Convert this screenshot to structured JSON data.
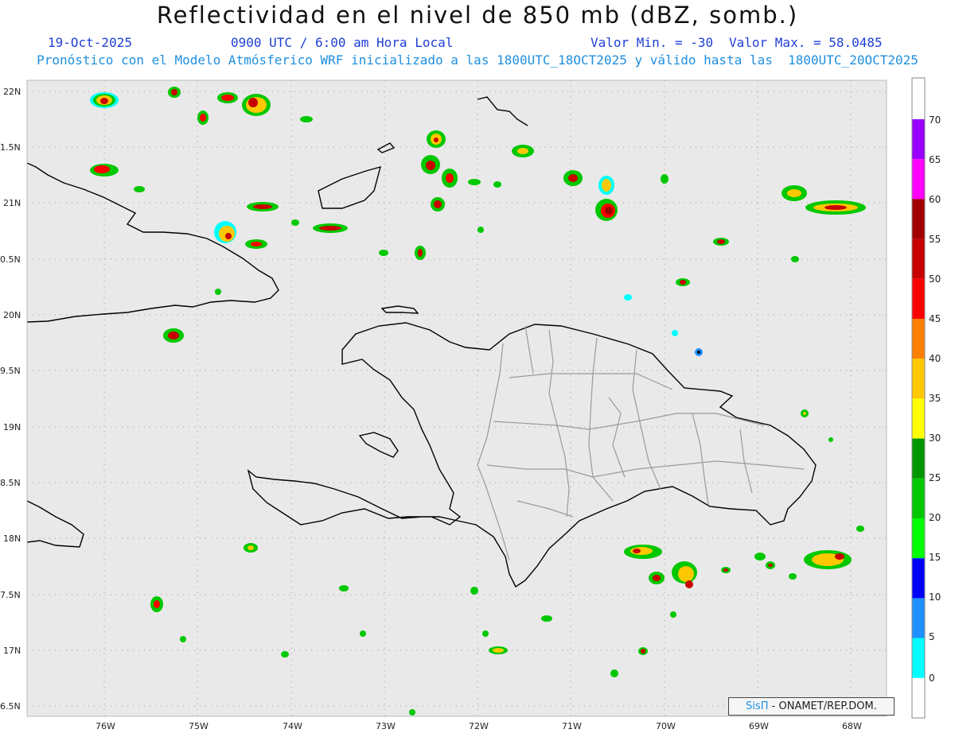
{
  "header": {
    "title": "Reflectividad en el nivel de 850 mb (dBZ, somb.)",
    "date": "19-Oct-2025",
    "time": "0900 UTC / 6:00 am Hora Local",
    "min_label": "Valor Min. = -30",
    "max_label": "Valor Max. = 58.0485",
    "subtitle": "Pronóstico con el Modelo Atmósferico WRF inicializado a las 1800UTC_18OCT2025 y válido hasta las  1800UTC_20OCT2025"
  },
  "axes": {
    "lat_labels": [
      "22N",
      "1.5N",
      "21N",
      "0.5N",
      "20N",
      "9.5N",
      "19N",
      "8.5N",
      "18N",
      "7.5N",
      "17N",
      "6.5N"
    ],
    "lon_labels": [
      "76W",
      "75W",
      "74W",
      "73W",
      "72W",
      "71W",
      "70W",
      "69W",
      "68W"
    ]
  },
  "colorbar": {
    "labels": [
      "70",
      "65",
      "60",
      "55",
      "50",
      "45",
      "40",
      "35",
      "30",
      "25",
      "20",
      "15",
      "10",
      "5",
      "0"
    ],
    "colors": [
      "#9900ff",
      "#ff00ff",
      "#a00000",
      "#c80000",
      "#ff0000",
      "#ff7f00",
      "#ffc800",
      "#ffff00",
      "#009600",
      "#00c800",
      "#00ff00",
      "#0000ff",
      "#1e90ff",
      "#00ffff",
      "#ffffff",
      "#e8e8e8"
    ]
  },
  "credit": {
    "brand": "SisΠ",
    "text": " - ONAMET/REP.DOM."
  },
  "map": {
    "background": "#e9e9e9",
    "coast_color": "#000000",
    "province_color": "#9a9a9a"
  }
}
